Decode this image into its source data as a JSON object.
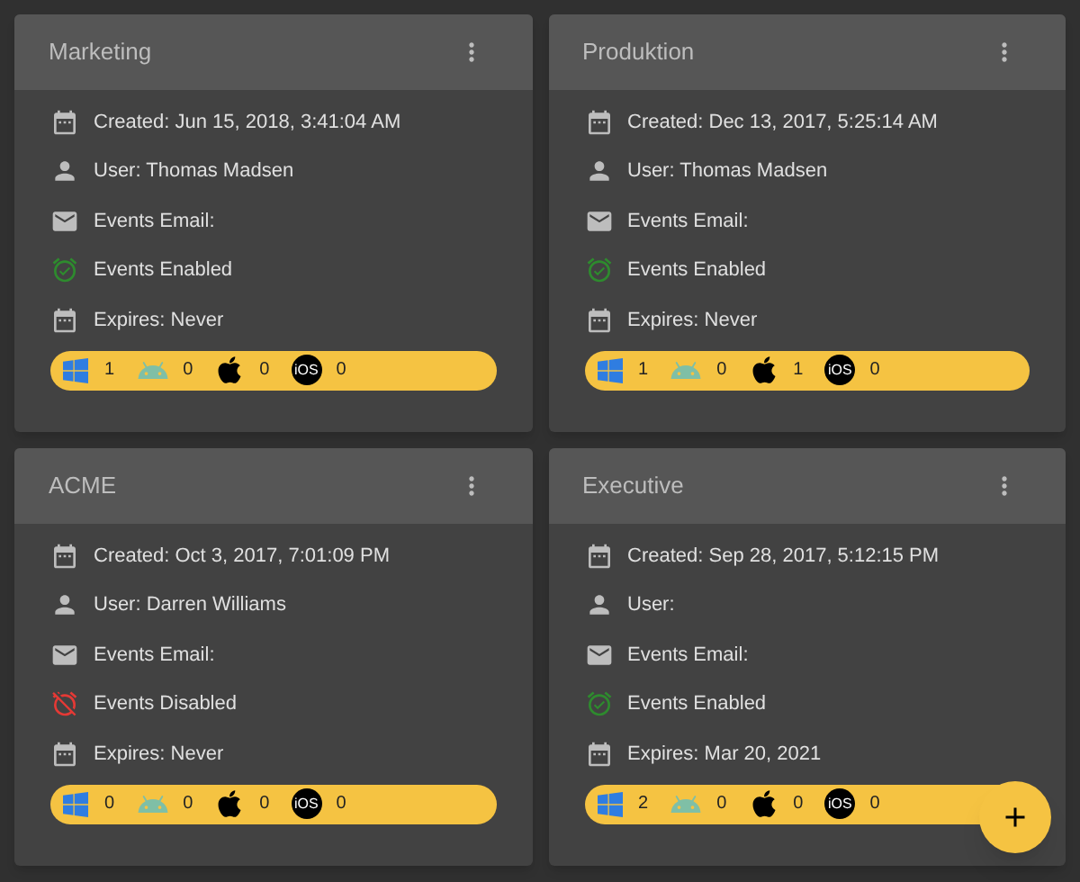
{
  "cards": [
    {
      "title": "Marketing",
      "created": "Created: Jun 15, 2018, 3:41:04 AM",
      "user": "User: Thomas Madsen",
      "email": "Events Email:",
      "events_enabled": true,
      "events_label": "Events Enabled",
      "expires": "Expires: Never",
      "platforms": [
        {
          "kind": "windows",
          "count": "1"
        },
        {
          "kind": "android",
          "count": "0"
        },
        {
          "kind": "apple",
          "count": "0"
        },
        {
          "kind": "ios",
          "label": "iOS",
          "count": "0"
        }
      ]
    },
    {
      "title": "Produktion",
      "created": "Created: Dec 13, 2017, 5:25:14 AM",
      "user": "User: Thomas Madsen",
      "email": "Events Email:",
      "events_enabled": true,
      "events_label": "Events Enabled",
      "expires": "Expires: Never",
      "platforms": [
        {
          "kind": "windows",
          "count": "1"
        },
        {
          "kind": "android",
          "count": "0"
        },
        {
          "kind": "apple",
          "count": "1"
        },
        {
          "kind": "ios",
          "label": "iOS",
          "count": "0"
        }
      ]
    },
    {
      "title": "ACME",
      "created": "Created: Oct 3, 2017, 7:01:09 PM",
      "user": "User: Darren Williams",
      "email": "Events Email:",
      "events_enabled": false,
      "events_label": "Events Disabled",
      "expires": "Expires: Never",
      "platforms": [
        {
          "kind": "windows",
          "count": "0"
        },
        {
          "kind": "android",
          "count": "0"
        },
        {
          "kind": "apple",
          "count": "0"
        },
        {
          "kind": "ios",
          "label": "iOS",
          "count": "0"
        }
      ]
    },
    {
      "title": "Executive",
      "created": "Created: Sep 28, 2017, 5:12:15 PM",
      "user": "User:",
      "email": "Events Email:",
      "events_enabled": true,
      "events_label": "Events Enabled",
      "expires": "Expires: Mar 20, 2021",
      "platforms": [
        {
          "kind": "windows",
          "count": "2"
        },
        {
          "kind": "android",
          "count": "0"
        },
        {
          "kind": "apple",
          "count": "0"
        },
        {
          "kind": "ios",
          "label": "iOS",
          "count": "0"
        }
      ]
    }
  ]
}
